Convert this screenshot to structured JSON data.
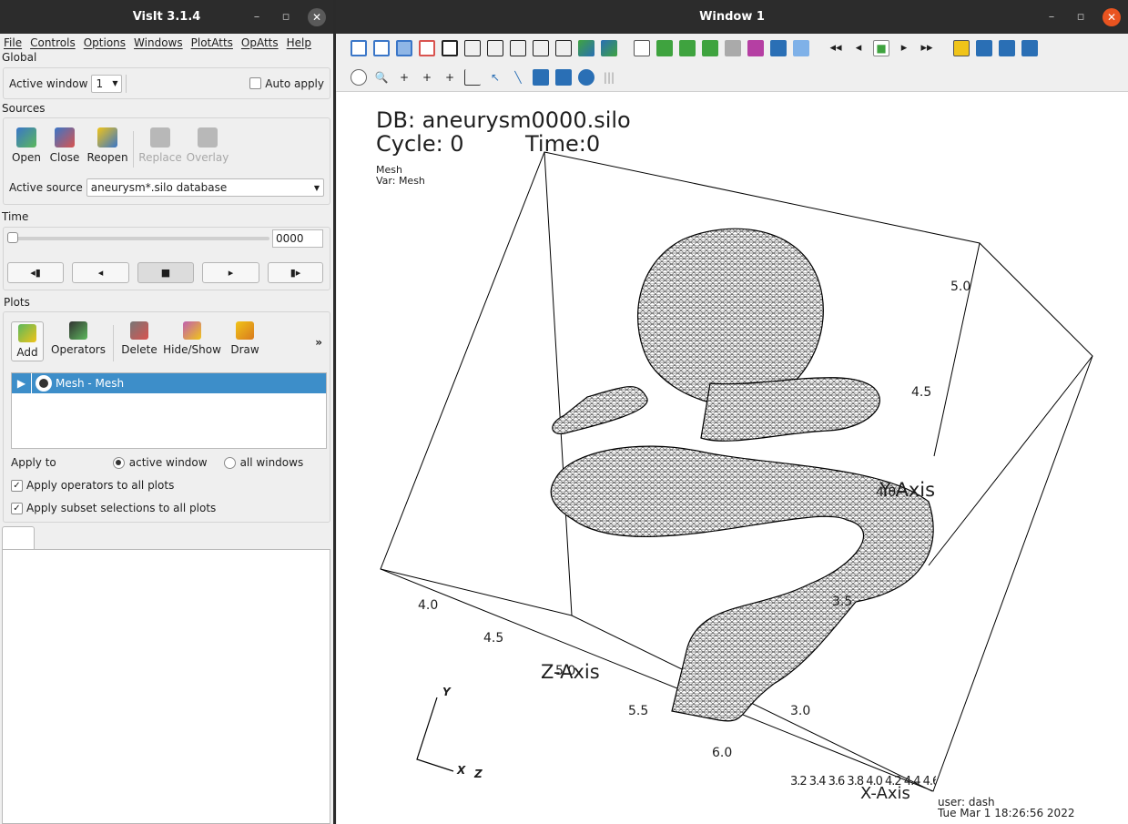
{
  "left": {
    "title": "VisIt 3.1.4",
    "menu": [
      "File",
      "Controls",
      "Options",
      "Windows",
      "PlotAtts",
      "OpAtts",
      "Help"
    ],
    "global": {
      "header": "Global",
      "active_window_label": "Active window",
      "active_window_value": "1",
      "auto_apply_label": "Auto apply"
    },
    "sources": {
      "header": "Sources",
      "buttons": [
        "Open",
        "Close",
        "Reopen",
        "Replace",
        "Overlay"
      ],
      "active_source_label": "Active source",
      "active_source_value": "aneurysm*.silo database"
    },
    "time": {
      "header": "Time",
      "value": "0000",
      "controls": [
        "◂▮",
        "◂",
        "■",
        "▸",
        "▮▸"
      ]
    },
    "plots": {
      "header": "Plots",
      "buttons": [
        "Add",
        "Operators",
        "Delete",
        "Hide/Show",
        "Draw"
      ],
      "more": "»",
      "list": [
        "Mesh - Mesh"
      ],
      "apply_to_label": "Apply to",
      "apply_active": "active window",
      "apply_all": "all windows",
      "apply_ops": "Apply operators to all plots",
      "apply_subset": "Apply subset selections to all plots"
    }
  },
  "right": {
    "title": "Window 1",
    "annotations": {
      "db": "DB: aneurysm0000.silo",
      "cycle": "Cycle: 0",
      "time": "Time:0",
      "plot_name": "Mesh",
      "var": "Var: Mesh",
      "user": "user: dash",
      "date": "Tue Mar  1 18:26:56 2022"
    },
    "axes": {
      "y_title": "Y-Axis",
      "z_title": "Z-Axis",
      "x_title": "X-Axis",
      "y_ticks": [
        "5.0",
        "4.5",
        "4.0",
        "3.5",
        "3.0"
      ],
      "z_ticks": [
        "4.0",
        "4.5",
        "5.0",
        "5.5",
        "6.0"
      ],
      "x_ticks": "3.2 3.4 3.6 3.8 4.0 4.2 4.4 4.6",
      "triad_y": "Y",
      "triad_x": "X",
      "triad_z": "Z"
    }
  },
  "colors": {
    "titlebar": "#2c2c2c",
    "close_button": "#e95420",
    "selection": "#3d8ec9",
    "panel": "#efefef"
  }
}
